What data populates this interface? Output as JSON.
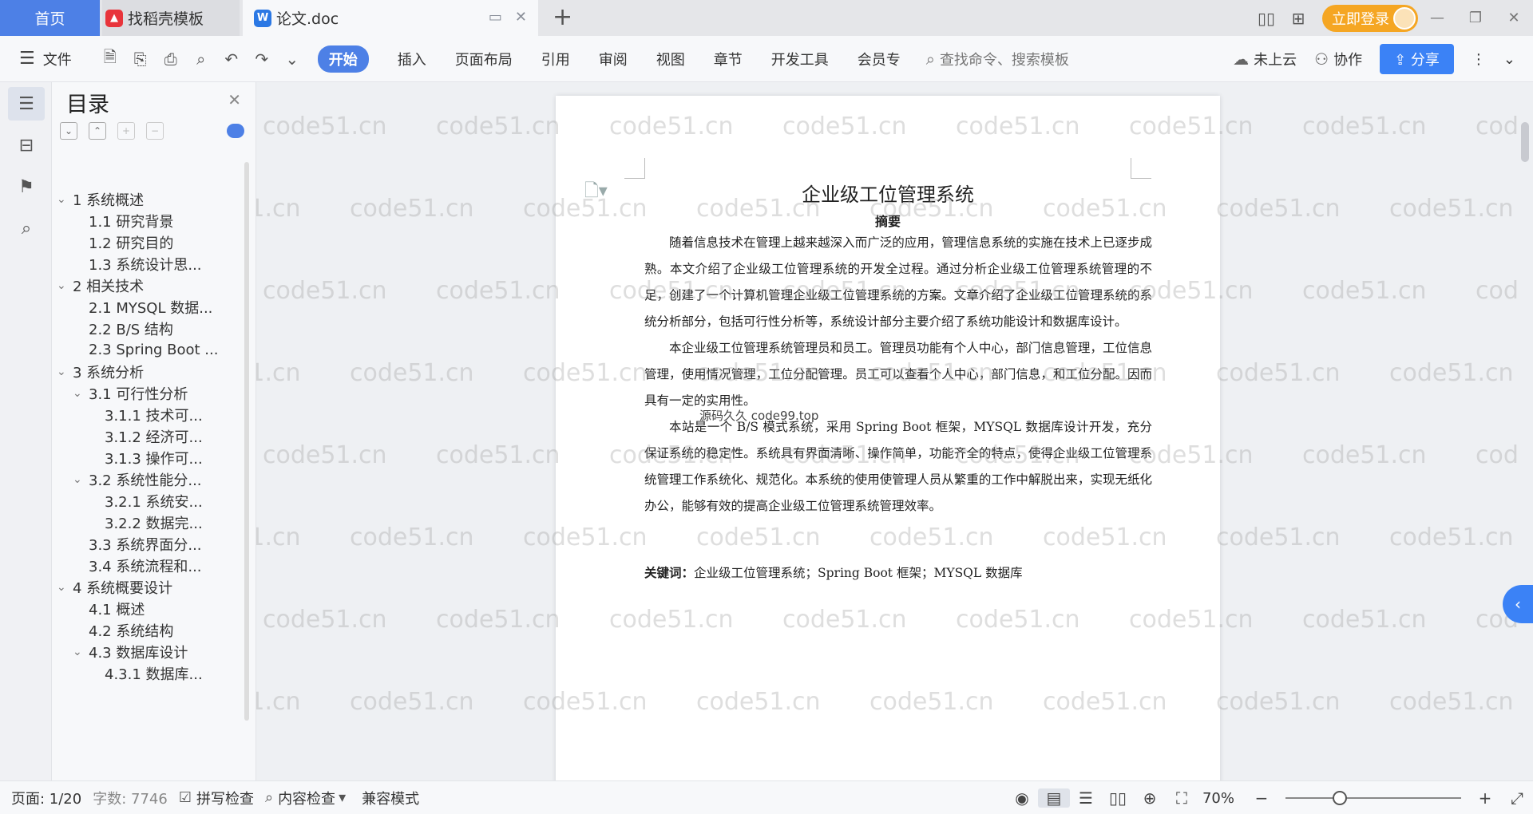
{
  "tabbar": {
    "home": "首页",
    "tabs": [
      {
        "label": "找稻壳模板",
        "icon": "daoke-icon"
      },
      {
        "label": "论文.doc",
        "icon": "wps-writer-icon"
      }
    ],
    "add": "+",
    "login": "立即登录"
  },
  "toolbar": {
    "file": "文件",
    "tabs": [
      "开始",
      "插入",
      "页面布局",
      "引用",
      "审阅",
      "视图",
      "章节",
      "开发工具",
      "会员专"
    ],
    "search_placeholder": "查找命令、搜索模板",
    "cloud": "未上云",
    "collab": "协作",
    "share": "分享"
  },
  "outline": {
    "title": "目录",
    "items": [
      {
        "label": "1 系统概述",
        "level": 1,
        "expanded": true
      },
      {
        "label": "1.1  研究背景",
        "level": 2
      },
      {
        "label": "1.2 研究目的",
        "level": 2
      },
      {
        "label": "1.3 系统设计思...",
        "level": 2
      },
      {
        "label": "2 相关技术",
        "level": 1,
        "expanded": true
      },
      {
        "label": "2.1 MYSQL 数据...",
        "level": 2
      },
      {
        "label": "2.2 B/S 结构",
        "level": 2
      },
      {
        "label": "2.3 Spring Boot ...",
        "level": 2
      },
      {
        "label": "3 系统分析",
        "level": 1,
        "expanded": true
      },
      {
        "label": "3.1 可行性分析",
        "level": 2,
        "expanded": true
      },
      {
        "label": "3.1.1 技术可...",
        "level": 3
      },
      {
        "label": "3.1.2 经济可...",
        "level": 3
      },
      {
        "label": "3.1.3 操作可...",
        "level": 3
      },
      {
        "label": "3.2 系统性能分...",
        "level": 2,
        "expanded": true
      },
      {
        "label": "3.2.1  系统安...",
        "level": 3
      },
      {
        "label": "3.2.2  数据完...",
        "level": 3
      },
      {
        "label": "3.3 系统界面分...",
        "level": 2
      },
      {
        "label": "3.4 系统流程和...",
        "level": 2
      },
      {
        "label": "4 系统概要设计",
        "level": 1,
        "expanded": true
      },
      {
        "label": "4.1 概述",
        "level": 2
      },
      {
        "label": "4.2 系统结构",
        "level": 2
      },
      {
        "label": "4.3 数据库设计",
        "level": 2,
        "expanded": true
      },
      {
        "label": "4.3.1 数据库...",
        "level": 3
      }
    ]
  },
  "document": {
    "title": "企业级工位管理系统",
    "subtitle": "摘要",
    "paragraphs": [
      "随着信息技术在管理上越来越深入而广泛的应用，管理信息系统的实施在技术上已逐步成熟。本文介绍了企业级工位管理系统的开发全过程。通过分析企业级工位管理系统管理的不足，创建了一个计算机管理企业级工位管理系统的方案。文章介绍了企业级工位管理系统的系统分析部分，包括可行性分析等，系统设计部分主要介绍了系统功能设计和数据库设计。",
      "本企业级工位管理系统管理员和员工。管理员功能有个人中心，部门信息管理，工位信息管理，使用情况管理，工位分配管理。员工可以查看个人中心，部门信息，和工位分配。因而具有一定的实用性。",
      "本站是一个 B/S 模式系统，采用 Spring Boot 框架，MYSQL 数据库设计开发，充分保证系统的稳定性。系统具有界面清晰、操作简单，功能齐全的特点，使得企业级工位管理系统管理工作系统化、规范化。本系统的使用使管理人员从繁重的工作中解脱出来，实现无纸化办公，能够有效的提高企业级工位管理系统管理效率。"
    ],
    "keywords_label": "关键词：",
    "keywords": "企业级工位管理系统；Spring Boot 框架；MYSQL 数据库",
    "stamp": "源码久久  code99.top"
  },
  "watermark": "code51.cn",
  "status": {
    "page": "页面: 1/20",
    "words": "字数: 7746",
    "spell": "拼写检查",
    "content_check": "内容检查",
    "compat": "兼容模式",
    "zoom": "70%",
    "zoom_level": 0.27
  },
  "colors": {
    "accent": "#4d80e6",
    "login": "#f5a623",
    "share": "#3b82f6"
  }
}
